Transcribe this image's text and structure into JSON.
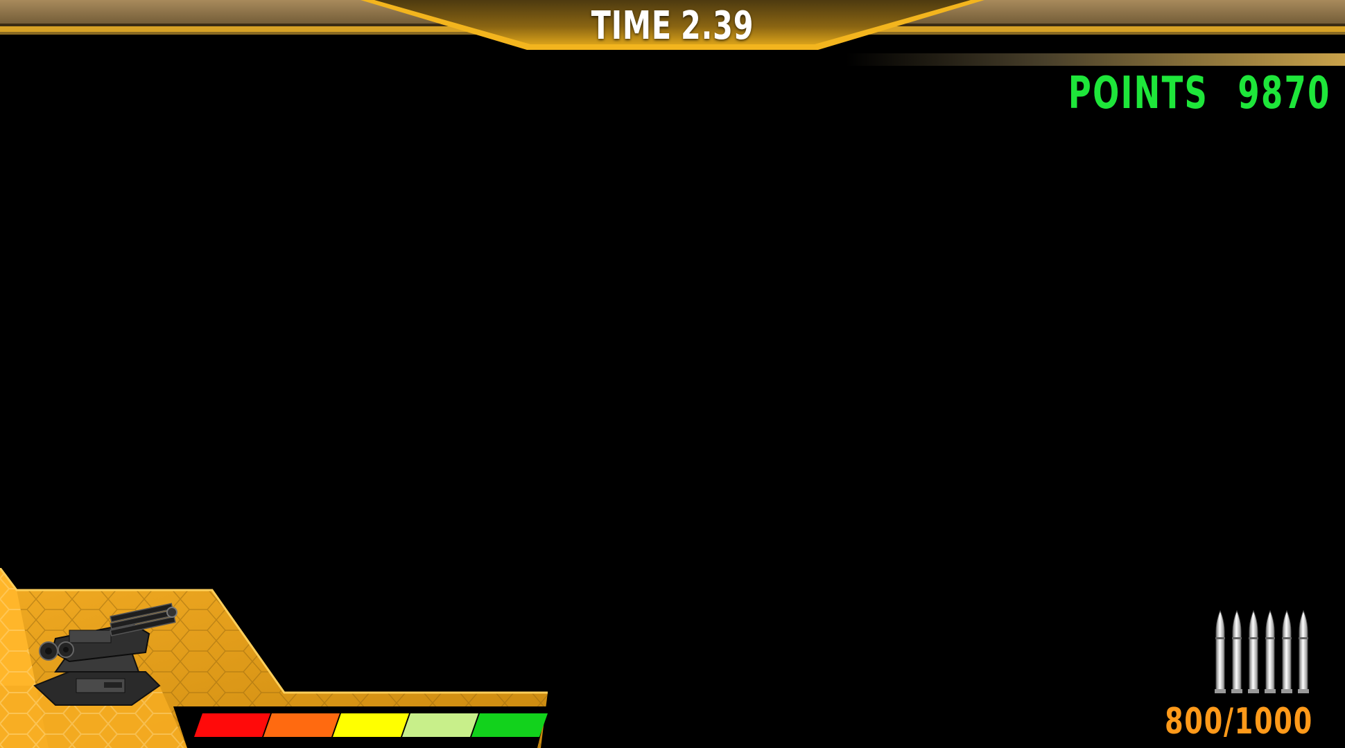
{
  "hud": {
    "timer": {
      "label": "TIME",
      "value": "2.39"
    },
    "score": {
      "label": "POINTS",
      "value": "9870"
    },
    "ammo": {
      "count": "800/1000",
      "rounds_shown": 6
    },
    "health": {
      "segments": 5,
      "colors": [
        "#ff0a0a",
        "#ff6a10",
        "#ffff00",
        "#c8ef8a",
        "#12d21c"
      ]
    },
    "unit": {
      "icon": "gatling-turret-icon"
    }
  },
  "colors": {
    "background": "#000000",
    "frame_gold": "#e0a51c",
    "points_green": "#1ee63a",
    "ammo_orange": "#ff9a1a",
    "timer_text": "#ffffff"
  }
}
